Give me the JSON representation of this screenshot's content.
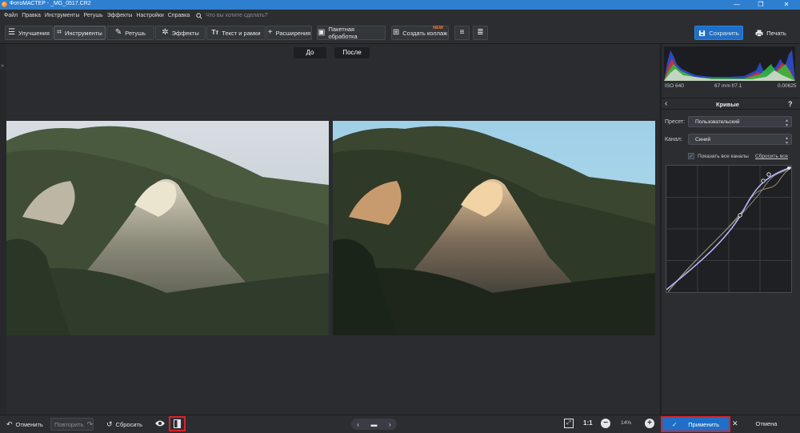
{
  "window": {
    "title": "ФотоМАСТЕР - _MG_0517.CR2",
    "controls": [
      "—",
      "❐",
      "✕"
    ]
  },
  "menu": {
    "items": [
      "Файл",
      "Правка",
      "Инструменты",
      "Ретушь",
      "Эффекты",
      "Настройки",
      "Справка"
    ],
    "search_placeholder": "Что вы хотите сделать?"
  },
  "toolbar": {
    "tabs": [
      "Улучшения",
      "Инструменты",
      "Ретушь",
      "Эффекты",
      "Текст и рамки",
      "Расширения"
    ],
    "active_tab": "Инструменты",
    "batch": "Пакетная обработка",
    "collage": "Создать коллаж",
    "collage_badge": "NEW",
    "save": "Сохранить",
    "print": "Печать"
  },
  "view": {
    "before": "До",
    "after": "После"
  },
  "panel": {
    "exif": {
      "iso": "ISO 640",
      "lens": "67 mm f/7.1",
      "shutter": "0.00625"
    },
    "title": "Кривые",
    "help": "?",
    "preset_label": "Пресет:",
    "preset_value": "Пользовательский",
    "channel_label": "Канал:",
    "channel_value": "Синий",
    "show_all_channels": "Показать все каналы",
    "reset_all": "Сбросить все",
    "apply": "Применить",
    "cancel": "Отмена"
  },
  "bottom": {
    "undo": "Отменить",
    "redo": "Повторить",
    "reset": "Сбросить",
    "ratio": "1:1",
    "zoom": "14%"
  },
  "colors": {
    "accent": "#1f6fc6",
    "highlight": "#e0202a",
    "titlebar": "#2e7fcf"
  }
}
